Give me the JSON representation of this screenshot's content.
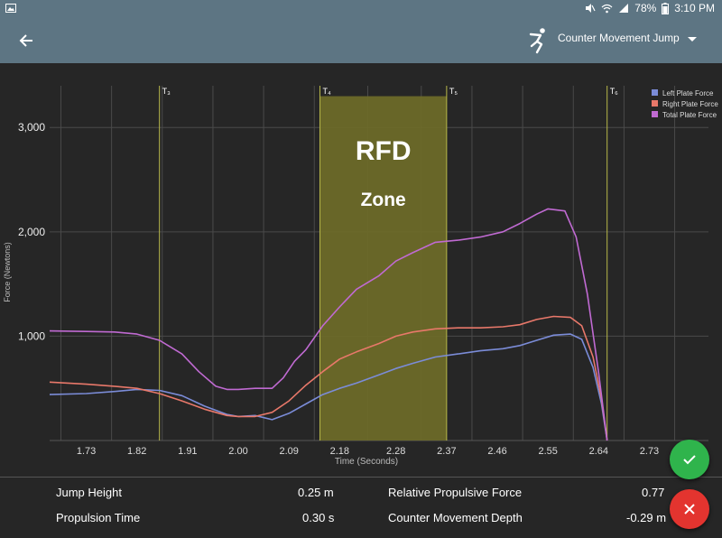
{
  "status_bar": {
    "battery": "78%",
    "time": "3:10 PM",
    "icons": [
      "gallery-icon",
      "mute-icon",
      "wifi-icon",
      "signal-icon",
      "battery-icon"
    ]
  },
  "app_bar": {
    "back_icon": "arrow-left-icon",
    "test_icon": "jumping-person-icon",
    "test_name": "Counter Movement Jump",
    "dropdown_icon": "caret-down-icon"
  },
  "colors": {
    "app_bar": "#5d7583",
    "background": "#262626",
    "left_plate": "#7b8cd8",
    "right_plate": "#e8786a",
    "total_plate": "#c06ad2",
    "rfd_zone": "#6e6b28",
    "marker": "#b8b84a",
    "accept": "#2fb44c",
    "cancel": "#e3342f"
  },
  "chart_data": {
    "type": "line",
    "xlabel": "Time (Seconds)",
    "ylabel": "Force (Newtons)",
    "xlim": [
      1.665,
      2.835
    ],
    "ylim": [
      0,
      3400
    ],
    "x_ticks": [
      1.73,
      1.82,
      1.91,
      2.0,
      2.09,
      2.18,
      2.28,
      2.37,
      2.46,
      2.55,
      2.64,
      2.73
    ],
    "x_tick_labels": [
      "1.73",
      "1.82",
      "1.91",
      "2.00",
      "2.09",
      "2.18",
      "2.28",
      "2.37",
      "2.46",
      "2.55",
      "2.64",
      "2.73"
    ],
    "y_ticks": [
      1000,
      2000,
      3000
    ],
    "y_tick_labels": [
      "1,000",
      "2,000",
      "3,000"
    ],
    "grid": true,
    "legend_position": "top-right",
    "markers": [
      {
        "label": "T₃",
        "x": 1.86
      },
      {
        "label": "T₄",
        "x": 2.145
      },
      {
        "label": "T₅",
        "x": 2.37
      },
      {
        "label": "T₆",
        "x": 2.655
      }
    ],
    "zone": {
      "x_start": 2.145,
      "x_end": 2.37,
      "y_top": 3300,
      "title": "RFD",
      "subtitle": "Zone"
    },
    "series": [
      {
        "name": "Left Plate Force",
        "color": "#7b8cd8",
        "x": [
          1.665,
          1.73,
          1.78,
          1.82,
          1.86,
          1.9,
          1.94,
          1.98,
          2.0,
          2.03,
          2.06,
          2.09,
          2.12,
          2.15,
          2.18,
          2.21,
          2.25,
          2.28,
          2.31,
          2.35,
          2.39,
          2.43,
          2.47,
          2.5,
          2.53,
          2.56,
          2.59,
          2.61,
          2.63,
          2.645,
          2.655
        ],
        "y": [
          440,
          450,
          470,
          490,
          480,
          430,
          330,
          250,
          230,
          240,
          200,
          260,
          350,
          440,
          500,
          550,
          630,
          690,
          740,
          800,
          830,
          860,
          880,
          910,
          960,
          1010,
          1020,
          970,
          700,
          350,
          0
        ]
      },
      {
        "name": "Right Plate Force",
        "color": "#e8786a",
        "x": [
          1.665,
          1.73,
          1.78,
          1.82,
          1.86,
          1.9,
          1.94,
          1.98,
          2.0,
          2.03,
          2.06,
          2.09,
          2.12,
          2.15,
          2.18,
          2.21,
          2.25,
          2.28,
          2.31,
          2.35,
          2.39,
          2.43,
          2.47,
          2.5,
          2.53,
          2.56,
          2.59,
          2.61,
          2.63,
          2.645,
          2.655
        ],
        "y": [
          560,
          540,
          520,
          500,
          450,
          380,
          300,
          240,
          230,
          230,
          270,
          380,
          530,
          660,
          780,
          850,
          930,
          1000,
          1040,
          1070,
          1080,
          1080,
          1090,
          1110,
          1160,
          1190,
          1180,
          1100,
          800,
          400,
          0
        ]
      },
      {
        "name": "Total Plate Force",
        "color": "#c06ad2",
        "x": [
          1.665,
          1.73,
          1.78,
          1.82,
          1.86,
          1.9,
          1.93,
          1.96,
          1.98,
          2.0,
          2.03,
          2.06,
          2.08,
          2.1,
          2.12,
          2.15,
          2.18,
          2.21,
          2.25,
          2.28,
          2.31,
          2.35,
          2.39,
          2.43,
          2.47,
          2.5,
          2.53,
          2.55,
          2.58,
          2.6,
          2.62,
          2.64,
          2.655
        ],
        "y": [
          1050,
          1045,
          1040,
          1020,
          960,
          830,
          660,
          520,
          490,
          490,
          500,
          500,
          600,
          760,
          870,
          1100,
          1280,
          1450,
          1580,
          1720,
          1800,
          1900,
          1920,
          1950,
          2000,
          2080,
          2170,
          2220,
          2200,
          1950,
          1400,
          650,
          0
        ]
      }
    ]
  },
  "stats": {
    "jump_height_label": "Jump Height",
    "jump_height_value": "0.25 m",
    "propulsion_time_label": "Propulsion Time",
    "propulsion_time_value": "0.30 s",
    "relative_propulsive_force_label": "Relative Propulsive Force",
    "relative_propulsive_force_value": "0.77",
    "counter_movement_depth_label": "Counter Movement Depth",
    "counter_movement_depth_value": "-0.29 m"
  },
  "actions": {
    "accept_icon": "checkmark-icon",
    "cancel_icon": "close-icon"
  }
}
